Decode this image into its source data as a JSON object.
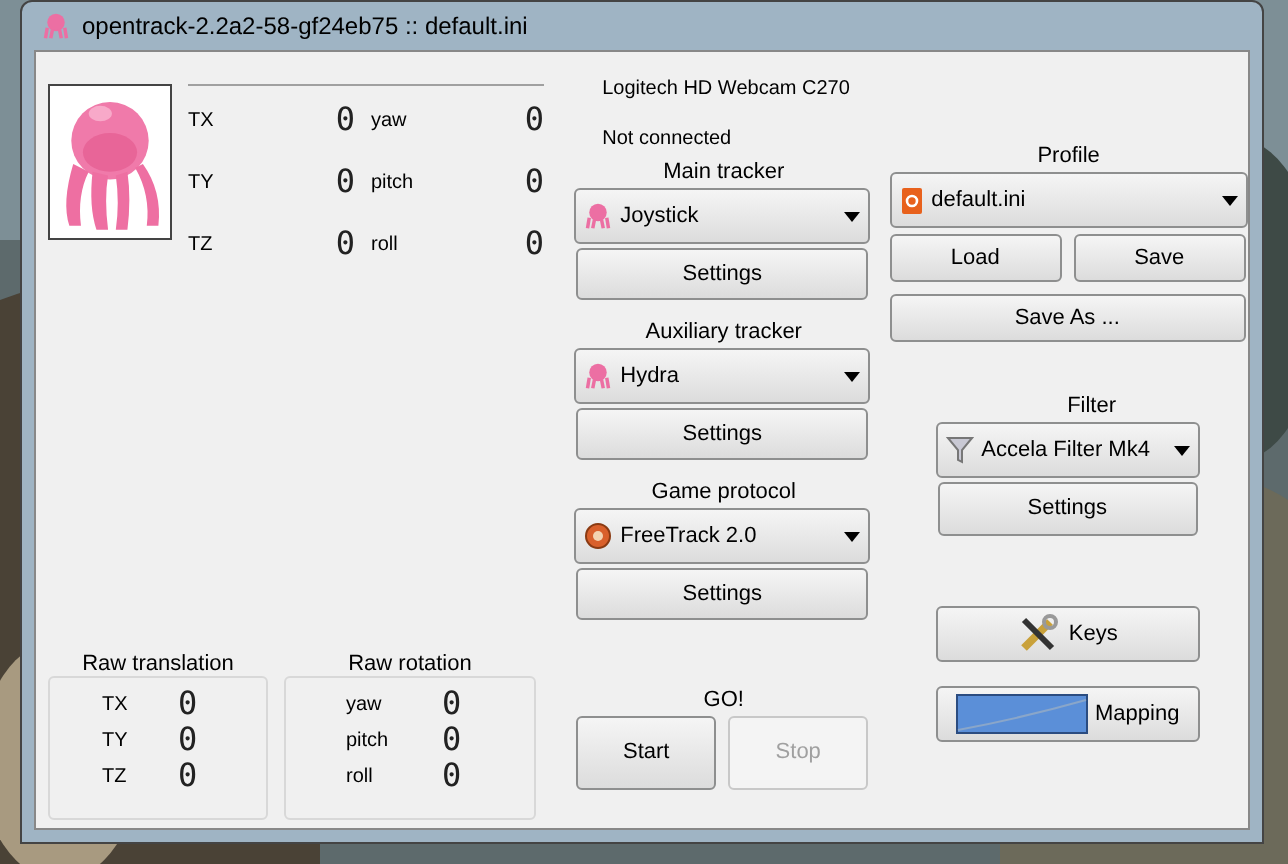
{
  "window": {
    "title": "opentrack-2.2a2-58-gf24eb75 :: default.ini"
  },
  "translation": [
    {
      "label": "TX",
      "value": "0"
    },
    {
      "label": "TY",
      "value": "0"
    },
    {
      "label": "TZ",
      "value": "0"
    }
  ],
  "rotation": [
    {
      "label": "yaw",
      "value": "0"
    },
    {
      "label": "pitch",
      "value": "0"
    },
    {
      "label": "roll",
      "value": "0"
    }
  ],
  "camera": {
    "name": "Logitech HD Webcam C270",
    "status": "Not connected"
  },
  "modules": [
    {
      "title": "Main tracker",
      "value": "Joystick",
      "button": "Settings"
    },
    {
      "title": "Auxiliary tracker",
      "value": "Hydra",
      "button": "Settings"
    },
    {
      "title": "Game protocol",
      "value": "FreeTrack 2.0",
      "button": "Settings"
    }
  ],
  "go": {
    "title": "GO!",
    "buttons": [
      {
        "label": "Start",
        "disabled": false
      },
      {
        "label": "Stop",
        "disabled": true
      }
    ]
  },
  "profile": {
    "title": "Profile",
    "value": "default.ini",
    "buttons": [
      "Load",
      "Save"
    ],
    "save_as": "Save As ..."
  },
  "filter": {
    "title": "Filter",
    "value": "Accela Filter Mk4",
    "button": "Settings"
  },
  "keys_button": "Keys",
  "mapping_button": "Mapping",
  "raw_translation": {
    "title": "Raw translation",
    "items": [
      {
        "label": "TX",
        "value": "0"
      },
      {
        "label": "TY",
        "value": "0"
      },
      {
        "label": "TZ",
        "value": "0"
      }
    ]
  },
  "raw_rotation": {
    "title": "Raw rotation",
    "items": [
      {
        "label": "yaw",
        "value": "0"
      },
      {
        "label": "pitch",
        "value": "0"
      },
      {
        "label": "roll",
        "value": "0"
      }
    ]
  }
}
